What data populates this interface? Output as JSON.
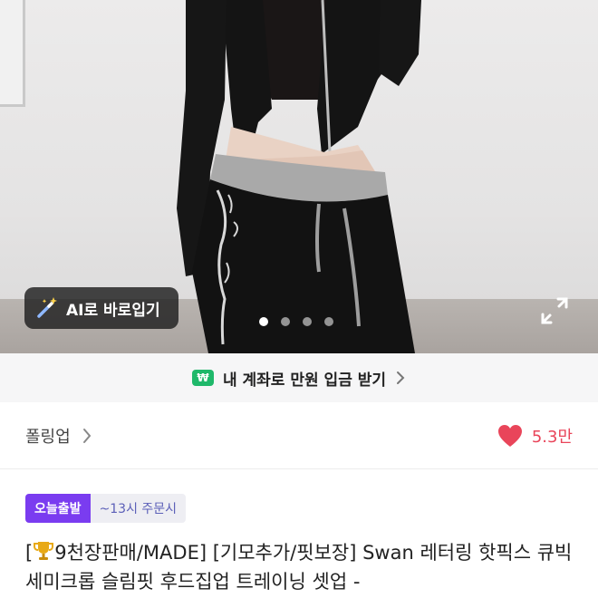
{
  "hero": {
    "ai_button_label": "AI로 바로입기",
    "carousel": {
      "count": 4,
      "active_index": 0
    }
  },
  "promo": {
    "badge": "₩",
    "text": "내 계좌로 만원 입금 받기"
  },
  "seller": {
    "name": "폴링업",
    "likes": "5.3만"
  },
  "badges": {
    "today_ship": "오늘출발",
    "cutoff": "~13시 주문시"
  },
  "product": {
    "title_open": "[",
    "title_rest": "9천장판매/MADE] [기모추가/핏보장] Swan 레터링 핫픽스 큐빅 세미크롭 슬림핏 후드집업 트레이닝 셋업 -"
  },
  "colors": {
    "accent_purple": "#7a3cf0",
    "like_red": "#e9455a",
    "won_green": "#1fb86a"
  },
  "icons": [
    "magic-wand-icon",
    "expand-icon",
    "chevron-right-icon",
    "heart-icon",
    "trophy-icon"
  ]
}
